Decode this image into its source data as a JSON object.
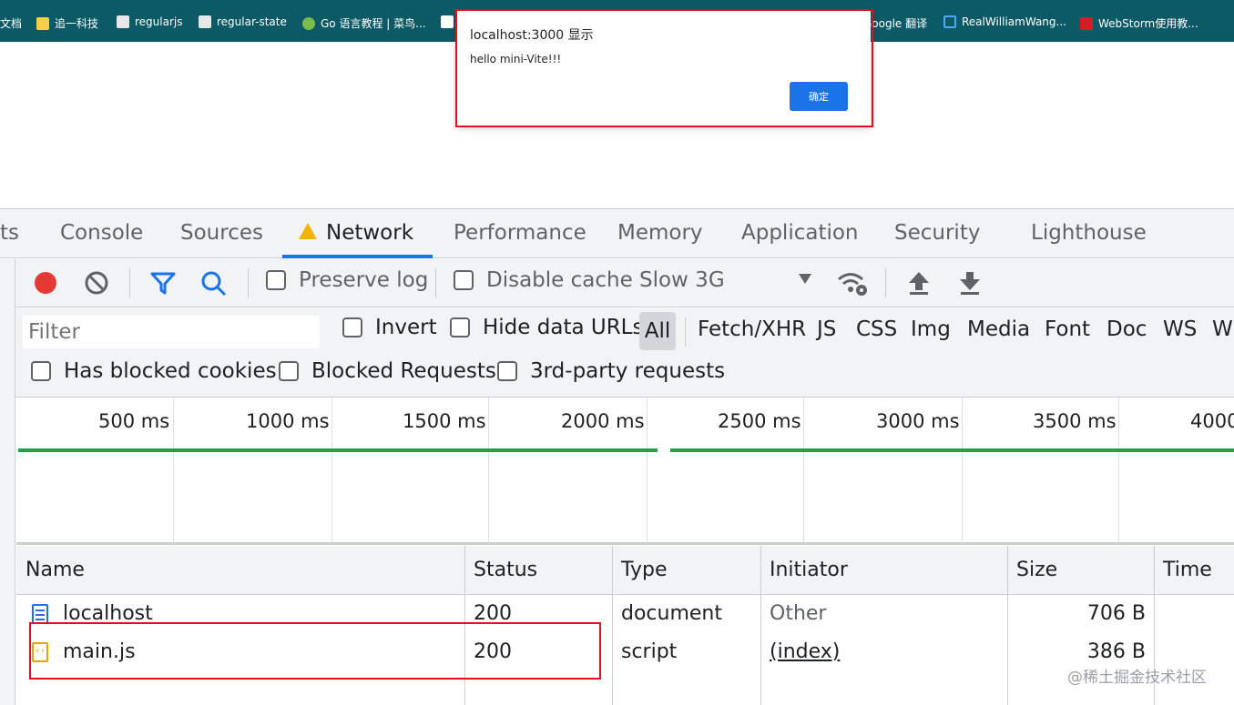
{
  "bookmarks": [
    {
      "label": "文档",
      "color": "#ffffff"
    },
    {
      "label": "追一科技",
      "color": "#f7d046"
    },
    {
      "label": "regularjs",
      "color": "#ffffff"
    },
    {
      "label": "regular-state",
      "color": "#ffffff"
    },
    {
      "label": "Go 语言教程 | 菜鸟...",
      "color": "#7cbc4d"
    },
    {
      "label": "Google 翻译",
      "color": "#4285f4"
    },
    {
      "label": "RealWilliamWang...",
      "color": "#4ea6ff"
    },
    {
      "label": "WebStorm使用教...",
      "color": "#d11f26"
    }
  ],
  "dialog": {
    "title": "localhost:3000 显示",
    "message": "hello mini-Vite!!!",
    "ok_label": "确定"
  },
  "devtools": {
    "tabs": [
      "ts",
      "Console",
      "Sources",
      "Network",
      "Performance",
      "Memory",
      "Application",
      "Security",
      "Lighthouse"
    ],
    "active_tab": "Network",
    "toolbar": {
      "preserve_log": "Preserve log",
      "disable_cache": "Disable cache",
      "throttling": "Slow 3G"
    },
    "filter": {
      "placeholder": "Filter",
      "invert": "Invert",
      "hide_data_urls": "Hide data URLs",
      "types": [
        "All",
        "Fetch/XHR",
        "JS",
        "CSS",
        "Img",
        "Media",
        "Font",
        "Doc",
        "WS",
        "W"
      ],
      "has_blocked_cookies": "Has blocked cookies",
      "blocked_requests": "Blocked Requests",
      "third_party": "3rd-party requests"
    },
    "timeline": {
      "ticks": [
        "500 ms",
        "1000 ms",
        "1500 ms",
        "2000 ms",
        "2500 ms",
        "3000 ms",
        "3500 ms",
        "4000"
      ]
    },
    "table": {
      "columns": [
        "Name",
        "Status",
        "Type",
        "Initiator",
        "Size",
        "Time"
      ],
      "rows": [
        {
          "name": "localhost",
          "status": "200",
          "type": "document",
          "initiator": "Other",
          "size": "706 B",
          "time": ""
        },
        {
          "name": "main.js",
          "status": "200",
          "type": "script",
          "initiator": "(index)",
          "size": "386 B",
          "time": ""
        }
      ]
    }
  },
  "watermark": "@稀土掘金技术社区",
  "colors": {
    "accent": "#1a73e8",
    "record": "#e53935",
    "highlight": "#e0101e",
    "timeline_bar": "#1ea446"
  }
}
